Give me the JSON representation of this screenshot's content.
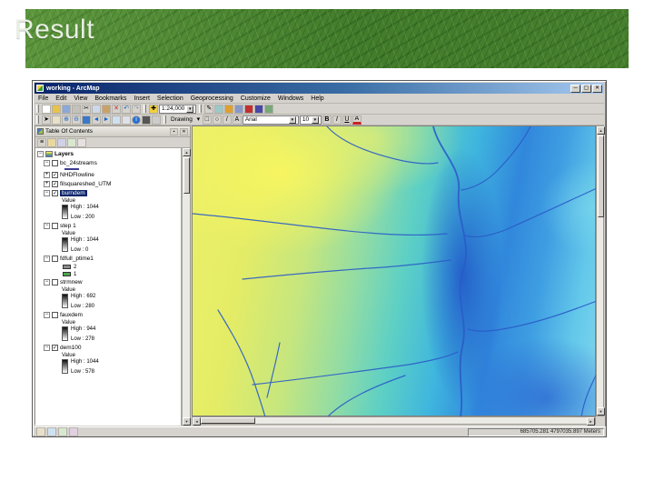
{
  "slide": {
    "title": "Result"
  },
  "window": {
    "title": "working - ArcMap",
    "controls": {
      "minimize": "─",
      "maximize": "▢",
      "close": "✕"
    },
    "menus": [
      "File",
      "Edit",
      "View",
      "Bookmarks",
      "Insert",
      "Selection",
      "Geoprocessing",
      "Customize",
      "Windows",
      "Help"
    ],
    "toolbar1": {
      "scale_value": "1:24,000"
    },
    "toolbar2": {
      "drawing_label": "Drawing",
      "font_name": "Arial",
      "font_size": "10",
      "bold": "B",
      "italic": "I",
      "underline": "U",
      "text_tool": "A",
      "font_color": "A"
    },
    "toc": {
      "title": "Table Of Contents",
      "root_label": "Layers",
      "root_exp": "−",
      "layers": [
        {
          "name": "bc_24streams",
          "exp": "−",
          "check": ""
        },
        {
          "name": "NHDFlowline",
          "exp": "+",
          "check": "✓"
        },
        {
          "name": "filsquareshed_UTM",
          "exp": "+",
          "check": "✓"
        },
        {
          "name": "burndem",
          "exp": "−",
          "check": "✓",
          "legend_label": "Value",
          "high": "High : 1044",
          "low": "Low : 200"
        },
        {
          "name": "step 1",
          "exp": "−",
          "check": "",
          "legend_label": "Value",
          "high": "High : 1044",
          "low": "Low : 0"
        },
        {
          "name": "fdfull_ptime1",
          "exp": "−",
          "check": "",
          "class1": "2",
          "class2": "1"
        },
        {
          "name": "strmnew",
          "exp": "−",
          "check": "",
          "legend_label": "Value",
          "high": "High : 692",
          "low": "Low : 280"
        },
        {
          "name": "fauxdem",
          "exp": "−",
          "check": "",
          "legend_label": "Value",
          "high": "High : 944",
          "low": "Low : 278"
        },
        {
          "name": "dem100",
          "exp": "−",
          "check": "✓",
          "legend_label": "Value",
          "high": "High : 1044",
          "low": "Low : 578"
        }
      ]
    },
    "statusbar": {
      "coordinates": "685705.281 4797035.897 Meters"
    }
  },
  "icons": {
    "dropdown": "▾",
    "cut": "✂",
    "delete": "✕",
    "undo": "↶",
    "redo": "↷",
    "add_data": "✚",
    "edit_pencil": "✎",
    "select_arrow": "➤",
    "zoom_in": "⊕",
    "zoom_out": "⊖",
    "back": "◄",
    "forward": "►",
    "identify": "i",
    "rect_tool": "□",
    "circle_tool": "○",
    "line_tool": "/",
    "pin": "▪",
    "close_small": "✕",
    "up": "▲",
    "down": "▼",
    "left": "◄",
    "right": "►",
    "list_view": "≡"
  },
  "accent_colors": {
    "titlebar_blue": "#0a246a",
    "selection_blue": "#0a246a",
    "header_green": "#4e8c34",
    "stream_blue": "#2a5cc8"
  }
}
